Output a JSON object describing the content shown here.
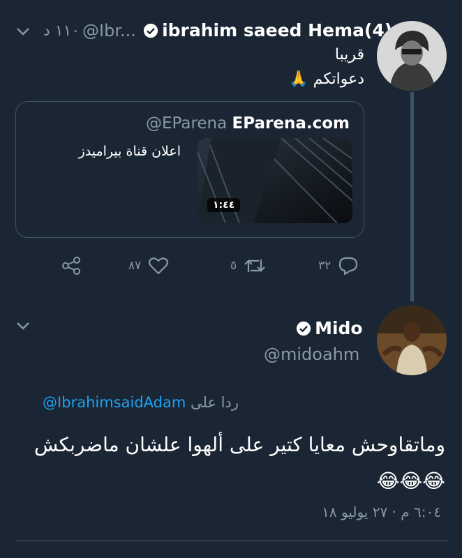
{
  "tweet1": {
    "name": "ibrahim saeed Hema(4)",
    "handle": "@Ibr...",
    "time": "١١٠ د",
    "text_line1": "قريبا",
    "text_line2": "دعواتكم 🙏",
    "card": {
      "handle": "@EParena",
      "site": "EParena.com",
      "description": "اعلان قناة بيراميدز",
      "duration": "١:٤٤"
    },
    "actions": {
      "reply_count": "٣٢",
      "retweet_count": "٥",
      "like_count": "٨٧"
    }
  },
  "tweet2": {
    "name": "Mido",
    "handle": "@midoahm",
    "reply_prefix": "ردا على",
    "reply_mention": "@IbrahimsaidAdam",
    "text": "وماتقاوحش معايا كتير على ألهوا علشان ماضربكش 😂😂😂",
    "timestamp": "٦:٠٤ م · ٢٧ يوليو ١٨"
  },
  "colors": {
    "background": "#1b2634",
    "muted": "#8899a6",
    "link": "#1da1f2",
    "border": "#3d5466"
  }
}
